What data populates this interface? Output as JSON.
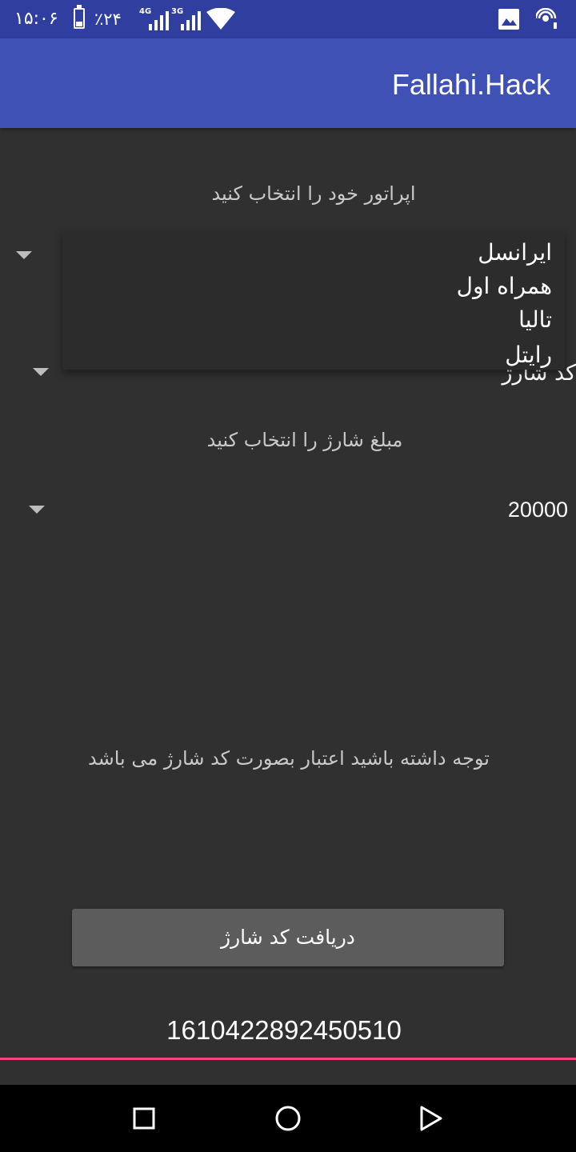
{
  "status_bar": {
    "time": "۱۵:۰۶",
    "battery_percent": "٪۲۴",
    "net_1": "4G",
    "net_2": "3G"
  },
  "app": {
    "title": "Fallahi.Hack"
  },
  "operator": {
    "label": "اپراتور خود را انتخاب کنید",
    "options": [
      "ایرانسل",
      "همراه اول",
      "تالیا",
      "رایتل"
    ]
  },
  "charge_type": {
    "value": "کد شارژ"
  },
  "amount": {
    "label": "مبلغ شارژ را انتخاب کنید",
    "value": "20000"
  },
  "notice": "توجه داشته باشید اعتبار بصورت کد شارژ می باشد",
  "get_button_label": "دریافت کد شارژ",
  "charge_code": "1610422892450510",
  "colors": {
    "status_bar": "#303f9f",
    "app_bar": "#3f51b5",
    "background": "#303030",
    "accent": "#ff4081"
  }
}
